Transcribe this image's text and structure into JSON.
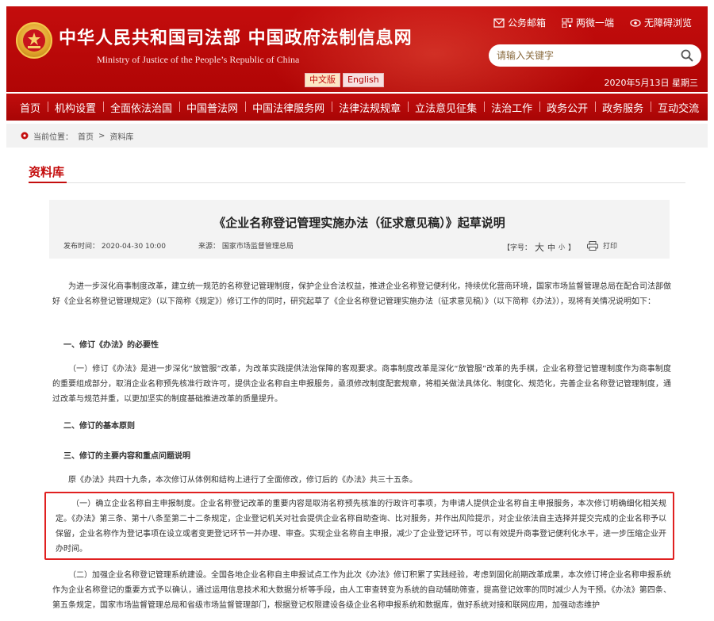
{
  "header": {
    "site_title": "中华人民共和国司法部  中国政府法制信息网",
    "site_subtitle": "Ministry of Justice of the People’s Republic of China",
    "lang_cn": "中文版",
    "lang_en": "English",
    "top_links": [
      {
        "label": "公务邮箱",
        "icon": "mail-icon"
      },
      {
        "label": "两微一端",
        "icon": "qr-icon"
      },
      {
        "label": "无障碍浏览",
        "icon": "eye-icon"
      }
    ],
    "search_placeholder": "请输入关键字",
    "date": "2020年5月13日 星期三"
  },
  "nav": {
    "items": [
      "首页",
      "机构设置",
      "全面依法治国",
      "中国普法网",
      "中国法律服务网",
      "法律法规规章",
      "立法意见征集",
      "法治工作",
      "政务公开",
      "政务服务",
      "互动交流"
    ]
  },
  "breadcrumb": {
    "label": "当前位置：",
    "home": "首页",
    "sep": ">",
    "current": "资料库"
  },
  "section": {
    "heading": "资料库"
  },
  "article": {
    "title": "《企业名称登记管理实施办法（征求意见稿）》起草说明",
    "publish_label": "发布时间：",
    "publish_time": "2020-04-30 10:00",
    "source_label": "来源：",
    "source": "国家市场监督管理总局",
    "fontsize_label": "【字号：",
    "fontsize_big": "大",
    "fontsize_mid": "中",
    "fontsize_small": "小",
    "fontsize_end": "】",
    "print_label": "打印"
  },
  "body": {
    "p1": "为进一步深化商事制度改革，建立统一规范的名称登记管理制度，保护企业合法权益，推进企业名称登记便利化，持续优化营商环境，国家市场监督管理总局在配合司法部做好《企业名称登记管理规定》（以下简称《规定》）修订工作的同时，研究起草了《企业名称登记管理实施办法（征求意见稿）》（以下简称《办法》），现将有关情况说明如下：",
    "h1": "一、修订《办法》的必要性",
    "p2": "（一）修订《办法》是进一步深化“放管服”改革，为改革实践提供法治保障的客观要求。商事制度改革是深化“放管服”改革的先手棋，企业名称登记管理制度作为商事制度的重要组成部分，取消企业名称预先核准行政许可，提供企业名称自主申报服务，亟须修改制度配套规章，将相关做法具体化、制度化、规范化，完善企业名称登记管理制度，通过改革与规范并重，以更加坚实的制度基础推进改革的质量提升。",
    "h2": "二、修订的基本原则",
    "h3": "三、修订的主要内容和重点问题说明",
    "p3": "原《办法》共四十九条，本次修订从体例和结构上进行了全面修改，修订后的《办法》共三十五条。",
    "p4": "（一）确立企业名称自主申报制度。企业名称登记改革的重要内容是取消名称预先核准的行政许可事项，为申请人提供企业名称自主申报服务，本次修订明确细化相关规定。《办法》第三条、第十八条至第二十二条规定，企业登记机关对社会提供企业名称自助查询、比对服务，并作出风险提示，对企业依法自主选择并提交完成的企业名称予以保留，企业名称作为登记事项在设立或者变更登记环节一并办理、审查。实现企业名称自主申报，减少了企业登记环节，可以有效提升商事登记便利化水平，进一步压缩企业开办时间。",
    "p5": "（二）加强企业名称登记管理系统建设。全国各地企业名称自主申报试点工作为此次《办法》修订积累了实践经验，考虑到固化前期改革成果，本次修订将企业名称申报系统作为企业名称登记的重要方式予以确认，通过运用信息技术和大数据分析等手段，由人工审查转变为系统的自动辅助筛查，提高登记效率的同时减少人为干预。《办法》第四条、第五条规定，国家市场监督管理总局和省级市场监督管理部门，根据登记权限建设各级企业名称申报系统和数据库，做好系统对接和联网应用，加强动态维护"
  },
  "colors": {
    "header_red": "#c40d0d",
    "highlight_border": "#e02020",
    "heading_red": "#c40d0d"
  }
}
